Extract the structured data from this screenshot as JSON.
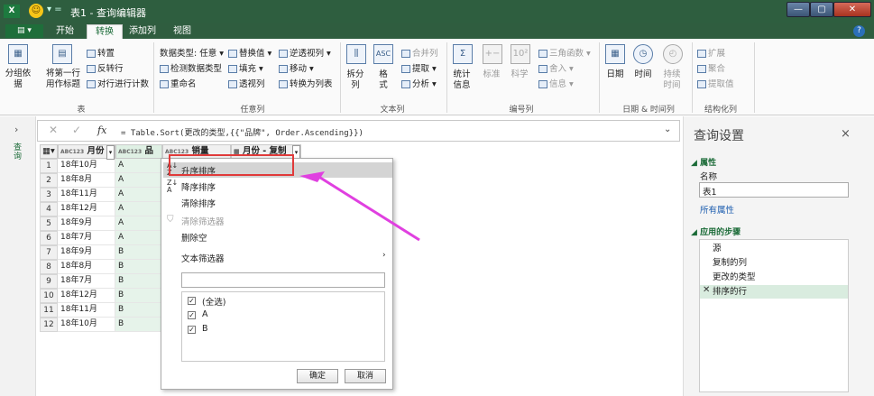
{
  "window": {
    "app_icon": "X",
    "title": "表1 - 查询编辑器",
    "qa": "▾ ="
  },
  "tabs": {
    "file": "▤ ▾",
    "items": [
      "开始",
      "转换",
      "添加列",
      "视图"
    ],
    "help": "?"
  },
  "ribbon": {
    "table": {
      "group_by": "分组依据",
      "use_first_row": "将第一行用作标题",
      "transpose": "转置",
      "reverse": "反转行",
      "count_rows": "对行进行计数",
      "label": "表"
    },
    "any": {
      "dtype": "数据类型: 任意",
      "detect": "检测数据类型",
      "rename": "重命名",
      "replace": "替换值",
      "fill": "填充",
      "pivot": "透视列",
      "unpivot": "逆透视列",
      "move": "移动",
      "to_list": "转换为列表",
      "label": "任意列"
    },
    "text": {
      "split": "拆分列",
      "format": "格式",
      "merge": "合并列",
      "extract": "提取",
      "parse": "分析",
      "label": "文本列"
    },
    "number": {
      "stats": "统计信息",
      "standard": "标准",
      "sci": "科学",
      "trig": "三角函数",
      "round": "舍入",
      "info": "信息",
      "label": "编号列"
    },
    "datetime": {
      "date": "日期",
      "time": "时间",
      "duration": "持续时间",
      "label": "日期 & 时间列"
    },
    "structured": {
      "expand": "扩展",
      "aggregate": "聚合",
      "extract_values": "提取值",
      "label": "结构化列"
    }
  },
  "formula": {
    "fx": "fx",
    "text": "= Table.Sort(更改的类型,{{\"品牌\", Order.Ascending}})"
  },
  "left_panel": {
    "label": "查询"
  },
  "grid": {
    "columns": [
      "月份",
      "品牌",
      "销量",
      "月份 - 复制"
    ],
    "rows": [
      [
        "18年10月",
        "A"
      ],
      [
        "18年8月",
        "A"
      ],
      [
        "18年11月",
        "A"
      ],
      [
        "18年12月",
        "A"
      ],
      [
        "18年9月",
        "A"
      ],
      [
        "18年7月",
        "A"
      ],
      [
        "18年9月",
        "B"
      ],
      [
        "18年8月",
        "B"
      ],
      [
        "18年7月",
        "B"
      ],
      [
        "18年12月",
        "B"
      ],
      [
        "18年11月",
        "B"
      ],
      [
        "18年10月",
        "B"
      ]
    ],
    "row_numbers": [
      "1",
      "2",
      "3",
      "4",
      "5",
      "6",
      "7",
      "8",
      "9",
      "10",
      "11",
      "12"
    ]
  },
  "menu": {
    "sort_asc": "升序排序",
    "sort_desc": "降序排序",
    "clear_sort": "清除排序",
    "clear_filter": "清除筛选器",
    "remove_empty": "删除空",
    "text_filters": "文本筛选器",
    "search_placeholder": "",
    "items": [
      "(全选)",
      "A",
      "B"
    ],
    "ok": "确定",
    "cancel": "取消"
  },
  "settings": {
    "title": "查询设置",
    "close": "×",
    "props_header": "属性",
    "name_label": "名称",
    "name_value": "表1",
    "all_props": "所有属性",
    "steps_header": "应用的步骤",
    "steps": [
      "源",
      "复制的列",
      "更改的类型",
      "排序的行"
    ]
  },
  "colors": {
    "accent_green": "#1b6b38",
    "highlight_red": "#e03a3a",
    "arrow_magenta": "#e040e0",
    "selected_step": "#d9ecdf"
  }
}
